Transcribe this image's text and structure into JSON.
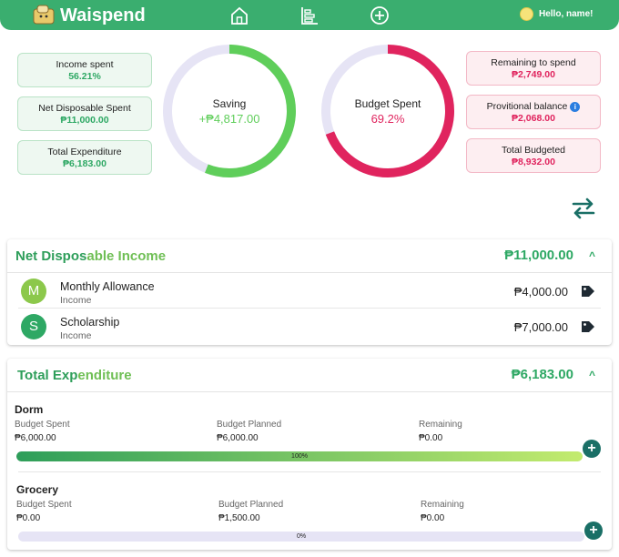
{
  "header": {
    "brand": "Waispend",
    "greeting": "Hello, name!"
  },
  "summary_left": [
    {
      "label": "Income spent",
      "value": "56.21%"
    },
    {
      "label": "Net Disposable Spent",
      "value": "₱11,000.00"
    },
    {
      "label": "Total Expenditure",
      "value": "₱6,183.00"
    }
  ],
  "summary_right": [
    {
      "label": "Remaining to spend",
      "value": "₱2,749.00"
    },
    {
      "label": "Provitional balance",
      "value": "₱2,068.00",
      "info_icon": "i"
    },
    {
      "label": "Total Budgeted",
      "value": "₱8,932.00"
    }
  ],
  "gauges": {
    "saving": {
      "label": "Saving",
      "value": "+₱4,817.00",
      "fraction": 0.56,
      "color": "#5fce5a"
    },
    "budget": {
      "label": "Budget Spent",
      "value": "69.2%",
      "fraction": 0.692,
      "color": "#e0245e"
    }
  },
  "income": {
    "title_a": "Net Dispos",
    "title_b": "able Income",
    "total": "₱11,000.00",
    "chevron": "^",
    "rows": [
      {
        "initial": "M",
        "name": "Monthly Allowance",
        "type": "Income",
        "amount": "₱4,000.00",
        "avatar_color": "#8cc84b"
      },
      {
        "initial": "S",
        "name": "Scholarship",
        "type": "Income",
        "amount": "₱7,000.00",
        "avatar_color": "#2ea864"
      }
    ]
  },
  "expenditure": {
    "title_a": "Total Exp",
    "title_b": "enditure",
    "total": "₱6,183.00",
    "chevron": "^",
    "col_labels": {
      "spent": "Budget Spent",
      "planned": "Budget Planned",
      "remaining": "Remaining"
    },
    "items": [
      {
        "name": "Dorm",
        "spent": "₱6,000.00",
        "planned": "₱6,000.00",
        "remaining": "₱0.00",
        "progress": 1.0,
        "progress_label": "100%"
      },
      {
        "name": "Grocery",
        "spent": "₱0.00",
        "planned": "₱1,500.00",
        "remaining": "₱0.00",
        "progress": 0.0,
        "progress_label": "0%"
      }
    ],
    "add_label": "+"
  },
  "colors": {
    "brand": "#3aae6f",
    "accent_pink": "#e0245e",
    "accent_dark": "#1a6f66"
  },
  "icons": [
    "logo-icon",
    "home-icon",
    "stats-icon",
    "add-circle-icon",
    "avatar-icon",
    "swap-icon",
    "tag-icon",
    "info-icon",
    "plus-icon"
  ]
}
